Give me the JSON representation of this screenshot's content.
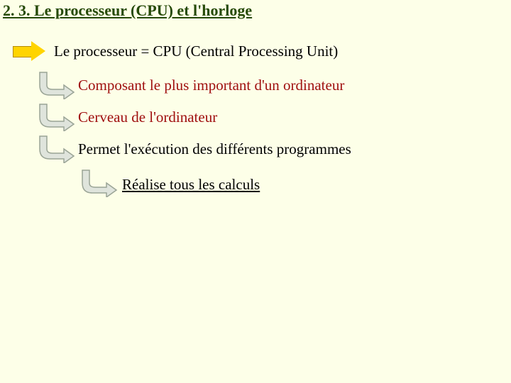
{
  "title": "2. 3. Le processeur (CPU) et l'horloge",
  "lines": {
    "definition": "Le processeur = CPU (Central Processing Unit)",
    "important": "Composant le plus important d'un ordinateur",
    "brain": "Cerveau de l'ordinateur",
    "execution": "Permet l'exécution des différents programmes",
    "calculs": "Réalise tous les calculs"
  },
  "icons": {
    "arrow_right": "arrow-right-yellow",
    "bent_arrow": "bent-arrow-grey"
  },
  "colors": {
    "background": "#fdffe8",
    "title": "#264a08",
    "emphasis": "#a01010",
    "arrow_fill": "#ffd400",
    "bent_fill": "#dfe4dc",
    "bent_stroke": "#9aa496"
  }
}
